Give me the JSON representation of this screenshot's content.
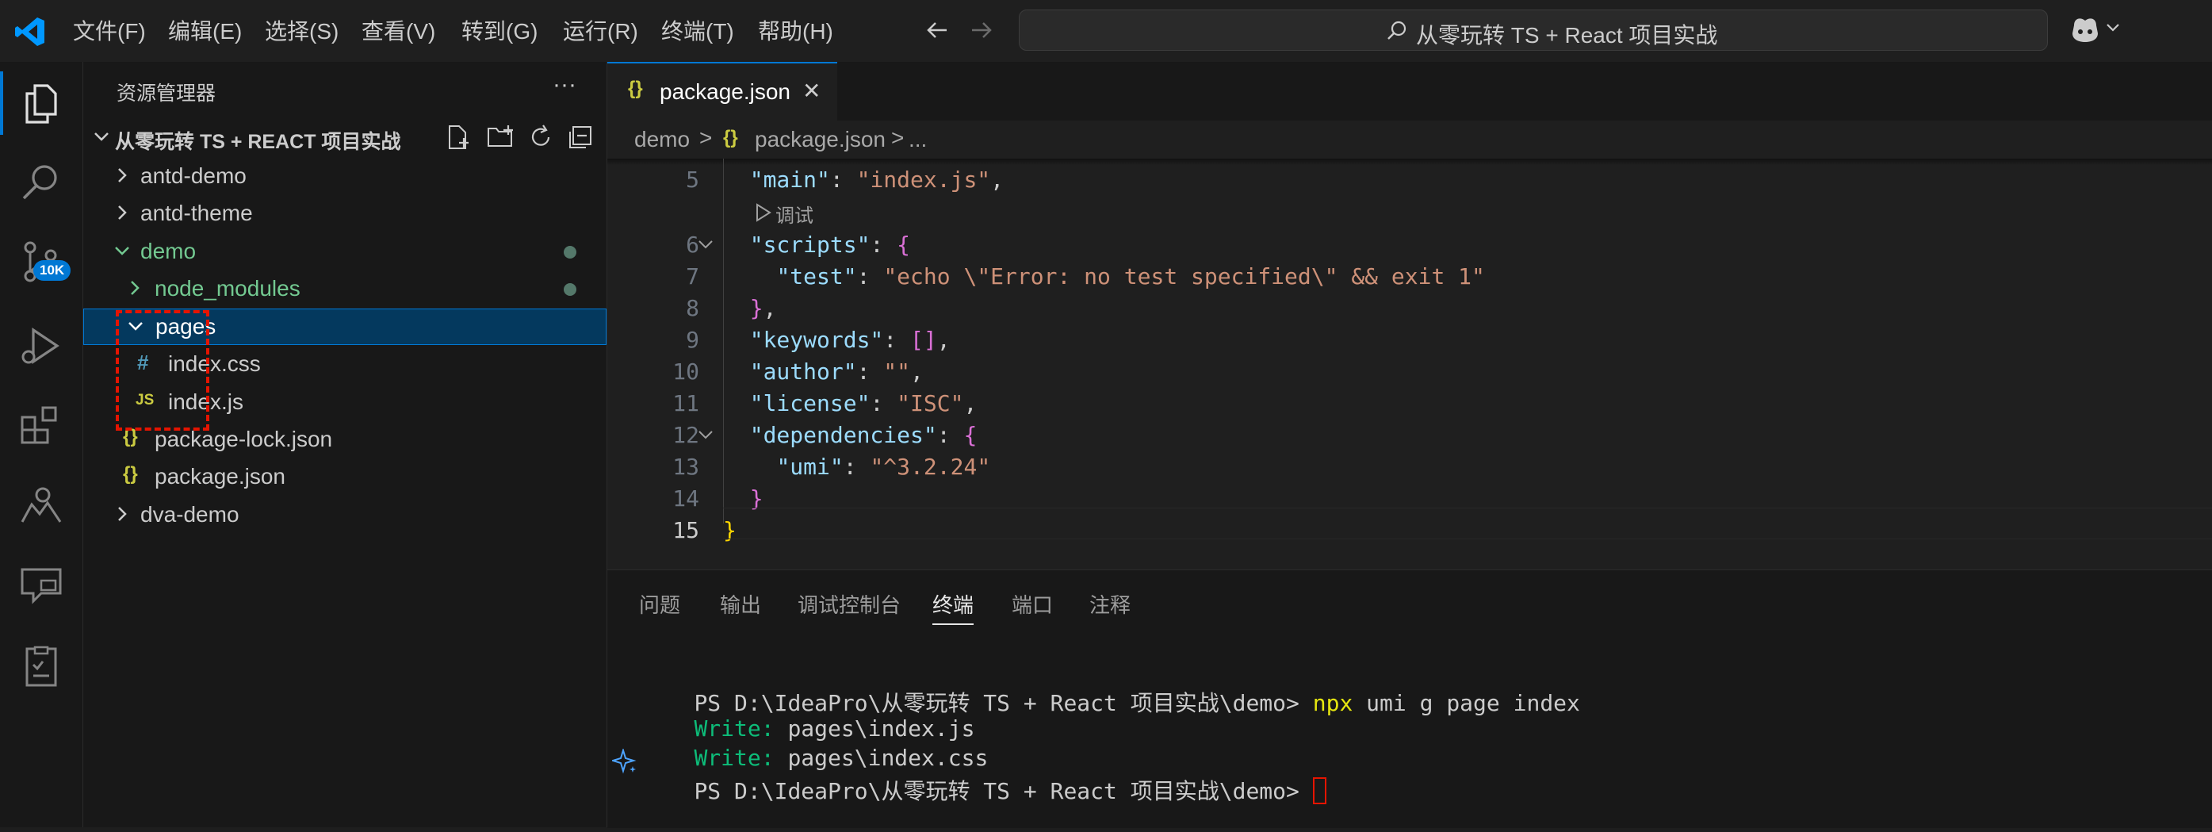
{
  "menu": [
    "文件(F)",
    "编辑(E)",
    "选择(S)",
    "查看(V)",
    "转到(G)",
    "运行(R)",
    "终端(T)",
    "帮助(H)"
  ],
  "search": {
    "text": "从零玩转 TS + React 项目实战"
  },
  "activity": {
    "badge": "10K"
  },
  "sidebar": {
    "title": "资源管理器",
    "more": "···",
    "root": "从零玩转 TS + REACT 项目实战",
    "items": [
      {
        "label": "antd-demo"
      },
      {
        "label": "antd-theme"
      },
      {
        "label": "demo"
      },
      {
        "label": "node_modules"
      },
      {
        "label": "pages"
      },
      {
        "label": "index.css",
        "icon": "#"
      },
      {
        "label": "index.js",
        "icon": "JS"
      },
      {
        "label": "package-lock.json",
        "icon": "{}"
      },
      {
        "label": "package.json",
        "icon": "{}"
      },
      {
        "label": "dva-demo"
      }
    ]
  },
  "editor": {
    "tab": {
      "icon": "{}",
      "label": "package.json",
      "close": "✕"
    },
    "breadcrumb": {
      "folder": "demo",
      "sep1": ">",
      "file": "package.json",
      "sep2": ">",
      "tail": "..."
    },
    "codelens": "调试",
    "lines": [
      {
        "n": "5",
        "parts": [
          {
            "t": "  "
          },
          {
            "k": "\"main\""
          },
          {
            "p": ": "
          },
          {
            "s": "\"index.js\""
          },
          {
            "p": ","
          }
        ]
      },
      {
        "n": "6",
        "parts": [
          {
            "t": "  "
          },
          {
            "k": "\"scripts\""
          },
          {
            "p": ": "
          },
          {
            "b2": "{"
          }
        ]
      },
      {
        "n": "7",
        "parts": [
          {
            "t": "    "
          },
          {
            "k": "\"test\""
          },
          {
            "p": ": "
          },
          {
            "s": "\"echo \\\"Error: no test specified\\\" && exit 1\""
          }
        ]
      },
      {
        "n": "8",
        "parts": [
          {
            "t": "  "
          },
          {
            "b2": "}"
          },
          {
            "p": ","
          }
        ]
      },
      {
        "n": "9",
        "parts": [
          {
            "t": "  "
          },
          {
            "k": "\"keywords\""
          },
          {
            "p": ": "
          },
          {
            "b2": "[]"
          },
          {
            "p": ","
          }
        ]
      },
      {
        "n": "10",
        "parts": [
          {
            "t": "  "
          },
          {
            "k": "\"author\""
          },
          {
            "p": ": "
          },
          {
            "s": "\"\""
          },
          {
            "p": ","
          }
        ]
      },
      {
        "n": "11",
        "parts": [
          {
            "t": "  "
          },
          {
            "k": "\"license\""
          },
          {
            "p": ": "
          },
          {
            "s": "\"ISC\""
          },
          {
            "p": ","
          }
        ]
      },
      {
        "n": "12",
        "parts": [
          {
            "t": "  "
          },
          {
            "k": "\"dependencies\""
          },
          {
            "p": ": "
          },
          {
            "b2": "{"
          }
        ]
      },
      {
        "n": "13",
        "parts": [
          {
            "t": "    "
          },
          {
            "k": "\"umi\""
          },
          {
            "p": ": "
          },
          {
            "s": "\"^3.2.24\""
          }
        ]
      },
      {
        "n": "14",
        "parts": [
          {
            "t": "  "
          },
          {
            "b2": "}"
          }
        ]
      },
      {
        "n": "15",
        "parts": [
          {
            "b1": "}"
          }
        ]
      }
    ]
  },
  "panel": {
    "tabs": [
      "问题",
      "输出",
      "调试控制台",
      "终端",
      "端口",
      "注释"
    ],
    "active_tab": "终端",
    "terminal": {
      "prompt": "PS D:\\IdeaPro\\从零玩转 TS + React 项目实战\\demo> ",
      "cmd_name": "npx",
      "cmd_args": " umi g page index",
      "write_label": "Write:",
      "write1": " pages\\index.js",
      "write2": " pages\\index.css",
      "prompt2": "PS D:\\IdeaPro\\从零玩转 TS + React 项目实战\\demo> "
    }
  },
  "colors": {
    "accent": "#0078d4",
    "folder_green": "#73c991",
    "highlight_red": "#e51400"
  }
}
